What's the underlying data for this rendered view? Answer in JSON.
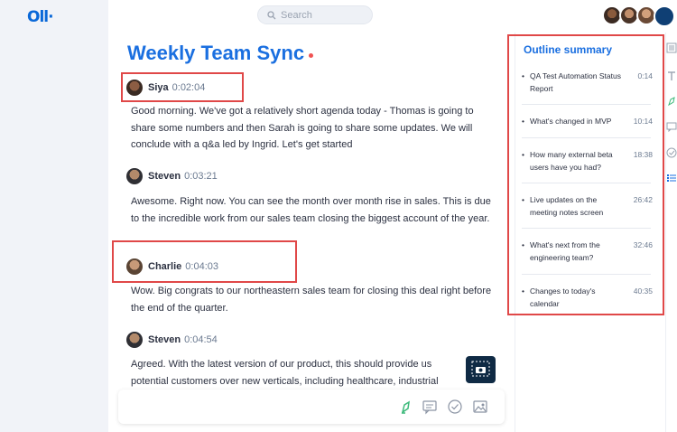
{
  "app": {
    "logo": "Oll·"
  },
  "search": {
    "placeholder": "Search"
  },
  "meeting": {
    "title": "Weekly Team Sync"
  },
  "transcript": [
    {
      "speaker": "Siya",
      "time": "0:02:04",
      "text": "Good morning. We've got a relatively short agenda today - Thomas is going to share some numbers and then Sarah is going to share some updates. We will conclude with a q&a led by Ingrid. Let's get started"
    },
    {
      "speaker": "Steven",
      "time": "0:03:21",
      "text": "Awesome. Right now. You can see the month over month rise in sales. This is due to the incredible work from our sales team closing the biggest account of the year."
    },
    {
      "speaker": "Charlie",
      "time": "0:04:03",
      "text": "Wow. Big congrats to our northeastern sales team for closing this deal right before the end of the quarter."
    },
    {
      "speaker": "Steven",
      "time": "0:04:54",
      "text": "Agreed. With the latest version of our product, this should provide us potential customers over new verticals, including healthcare, industrial"
    }
  ],
  "outline": {
    "title": "Outline summary",
    "items": [
      {
        "text": "QA Test Automation Status Report",
        "time": "0:14"
      },
      {
        "text": "What's changed in MVP",
        "time": "10:14"
      },
      {
        "text": "How many external beta users have you had?",
        "time": "18:38"
      },
      {
        "text": "Live updates on the meeting notes screen",
        "time": "26:42"
      },
      {
        "text": "What's next from the engineering team?",
        "time": "32:46"
      },
      {
        "text": "Changes to today's calendar",
        "time": "40:35"
      }
    ]
  },
  "colors": {
    "accent": "#1a6fe0",
    "highlight": "#e04848",
    "recording": "#f05252"
  }
}
